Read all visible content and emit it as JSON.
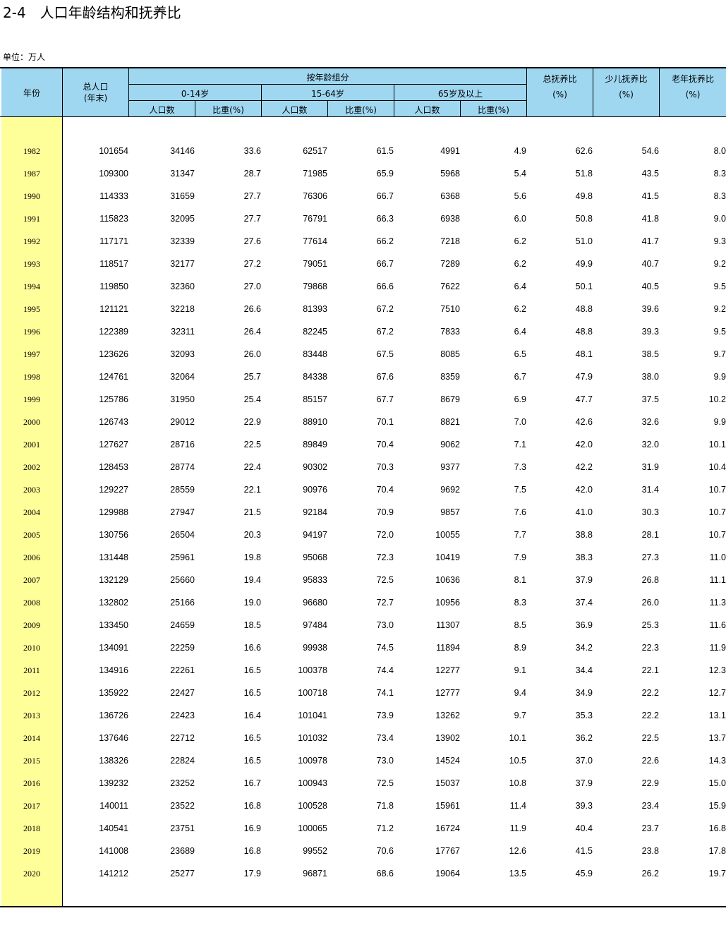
{
  "title": "2-4　人口年龄结构和抚养比",
  "unit_label": "单位：万人",
  "header": {
    "year": "年份",
    "total_population": [
      "总人口",
      "(年末)"
    ],
    "by_age_group": "按年龄组分",
    "group_0_14": "0-14岁",
    "group_15_64": "15-64岁",
    "group_65_plus": "65岁及以上",
    "population": "人口数",
    "proportion": "比重(%)",
    "total_dependency": [
      "总抚养比",
      "(%)"
    ],
    "child_dependency": [
      "少儿抚养比",
      "(%)"
    ],
    "old_dependency": [
      "老年抚养比",
      "(%)"
    ]
  },
  "rows": [
    [
      "1982",
      "101654",
      "34146",
      "33.6",
      "62517",
      "61.5",
      "4991",
      "4.9",
      "62.6",
      "54.6",
      "8.0"
    ],
    [
      "1987",
      "109300",
      "31347",
      "28.7",
      "71985",
      "65.9",
      "5968",
      "5.4",
      "51.8",
      "43.5",
      "8.3"
    ],
    [
      "1990",
      "114333",
      "31659",
      "27.7",
      "76306",
      "66.7",
      "6368",
      "5.6",
      "49.8",
      "41.5",
      "8.3"
    ],
    [
      "1991",
      "115823",
      "32095",
      "27.7",
      "76791",
      "66.3",
      "6938",
      "6.0",
      "50.8",
      "41.8",
      "9.0"
    ],
    [
      "1992",
      "117171",
      "32339",
      "27.6",
      "77614",
      "66.2",
      "7218",
      "6.2",
      "51.0",
      "41.7",
      "9.3"
    ],
    [
      "1993",
      "118517",
      "32177",
      "27.2",
      "79051",
      "66.7",
      "7289",
      "6.2",
      "49.9",
      "40.7",
      "9.2"
    ],
    [
      "1994",
      "119850",
      "32360",
      "27.0",
      "79868",
      "66.6",
      "7622",
      "6.4",
      "50.1",
      "40.5",
      "9.5"
    ],
    [
      "1995",
      "121121",
      "32218",
      "26.6",
      "81393",
      "67.2",
      "7510",
      "6.2",
      "48.8",
      "39.6",
      "9.2"
    ],
    [
      "1996",
      "122389",
      "32311",
      "26.4",
      "82245",
      "67.2",
      "7833",
      "6.4",
      "48.8",
      "39.3",
      "9.5"
    ],
    [
      "1997",
      "123626",
      "32093",
      "26.0",
      "83448",
      "67.5",
      "8085",
      "6.5",
      "48.1",
      "38.5",
      "9.7"
    ],
    [
      "1998",
      "124761",
      "32064",
      "25.7",
      "84338",
      "67.6",
      "8359",
      "6.7",
      "47.9",
      "38.0",
      "9.9"
    ],
    [
      "1999",
      "125786",
      "31950",
      "25.4",
      "85157",
      "67.7",
      "8679",
      "6.9",
      "47.7",
      "37.5",
      "10.2"
    ],
    [
      "2000",
      "126743",
      "29012",
      "22.9",
      "88910",
      "70.1",
      "8821",
      "7.0",
      "42.6",
      "32.6",
      "9.9"
    ],
    [
      "2001",
      "127627",
      "28716",
      "22.5",
      "89849",
      "70.4",
      "9062",
      "7.1",
      "42.0",
      "32.0",
      "10.1"
    ],
    [
      "2002",
      "128453",
      "28774",
      "22.4",
      "90302",
      "70.3",
      "9377",
      "7.3",
      "42.2",
      "31.9",
      "10.4"
    ],
    [
      "2003",
      "129227",
      "28559",
      "22.1",
      "90976",
      "70.4",
      "9692",
      "7.5",
      "42.0",
      "31.4",
      "10.7"
    ],
    [
      "2004",
      "129988",
      "27947",
      "21.5",
      "92184",
      "70.9",
      "9857",
      "7.6",
      "41.0",
      "30.3",
      "10.7"
    ],
    [
      "2005",
      "130756",
      "26504",
      "20.3",
      "94197",
      "72.0",
      "10055",
      "7.7",
      "38.8",
      "28.1",
      "10.7"
    ],
    [
      "2006",
      "131448",
      "25961",
      "19.8",
      "95068",
      "72.3",
      "10419",
      "7.9",
      "38.3",
      "27.3",
      "11.0"
    ],
    [
      "2007",
      "132129",
      "25660",
      "19.4",
      "95833",
      "72.5",
      "10636",
      "8.1",
      "37.9",
      "26.8",
      "11.1"
    ],
    [
      "2008",
      "132802",
      "25166",
      "19.0",
      "96680",
      "72.7",
      "10956",
      "8.3",
      "37.4",
      "26.0",
      "11.3"
    ],
    [
      "2009",
      "133450",
      "24659",
      "18.5",
      "97484",
      "73.0",
      "11307",
      "8.5",
      "36.9",
      "25.3",
      "11.6"
    ],
    [
      "2010",
      "134091",
      "22259",
      "16.6",
      "99938",
      "74.5",
      "11894",
      "8.9",
      "34.2",
      "22.3",
      "11.9"
    ],
    [
      "2011",
      "134916",
      "22261",
      "16.5",
      "100378",
      "74.4",
      "12277",
      "9.1",
      "34.4",
      "22.1",
      "12.3"
    ],
    [
      "2012",
      "135922",
      "22427",
      "16.5",
      "100718",
      "74.1",
      "12777",
      "9.4",
      "34.9",
      "22.2",
      "12.7"
    ],
    [
      "2013",
      "136726",
      "22423",
      "16.4",
      "101041",
      "73.9",
      "13262",
      "9.7",
      "35.3",
      "22.2",
      "13.1"
    ],
    [
      "2014",
      "137646",
      "22712",
      "16.5",
      "101032",
      "73.4",
      "13902",
      "10.1",
      "36.2",
      "22.5",
      "13.7"
    ],
    [
      "2015",
      "138326",
      "22824",
      "16.5",
      "100978",
      "73.0",
      "14524",
      "10.5",
      "37.0",
      "22.6",
      "14.3"
    ],
    [
      "2016",
      "139232",
      "23252",
      "16.7",
      "100943",
      "72.5",
      "15037",
      "10.8",
      "37.9",
      "22.9",
      "15.0"
    ],
    [
      "2017",
      "140011",
      "23522",
      "16.8",
      "100528",
      "71.8",
      "15961",
      "11.4",
      "39.3",
      "23.4",
      "15.9"
    ],
    [
      "2018",
      "140541",
      "23751",
      "16.9",
      "100065",
      "71.2",
      "16724",
      "11.9",
      "40.4",
      "23.7",
      "16.8"
    ],
    [
      "2019",
      "141008",
      "23689",
      "16.8",
      "99552",
      "70.6",
      "17767",
      "12.6",
      "41.5",
      "23.8",
      "17.8"
    ],
    [
      "2020",
      "141212",
      "25277",
      "17.9",
      "96871",
      "68.6",
      "19064",
      "13.5",
      "45.9",
      "26.2",
      "19.7"
    ]
  ],
  "colors": {
    "header_bg": "#9fd7f1",
    "year_col_bg": "#ffff99"
  }
}
